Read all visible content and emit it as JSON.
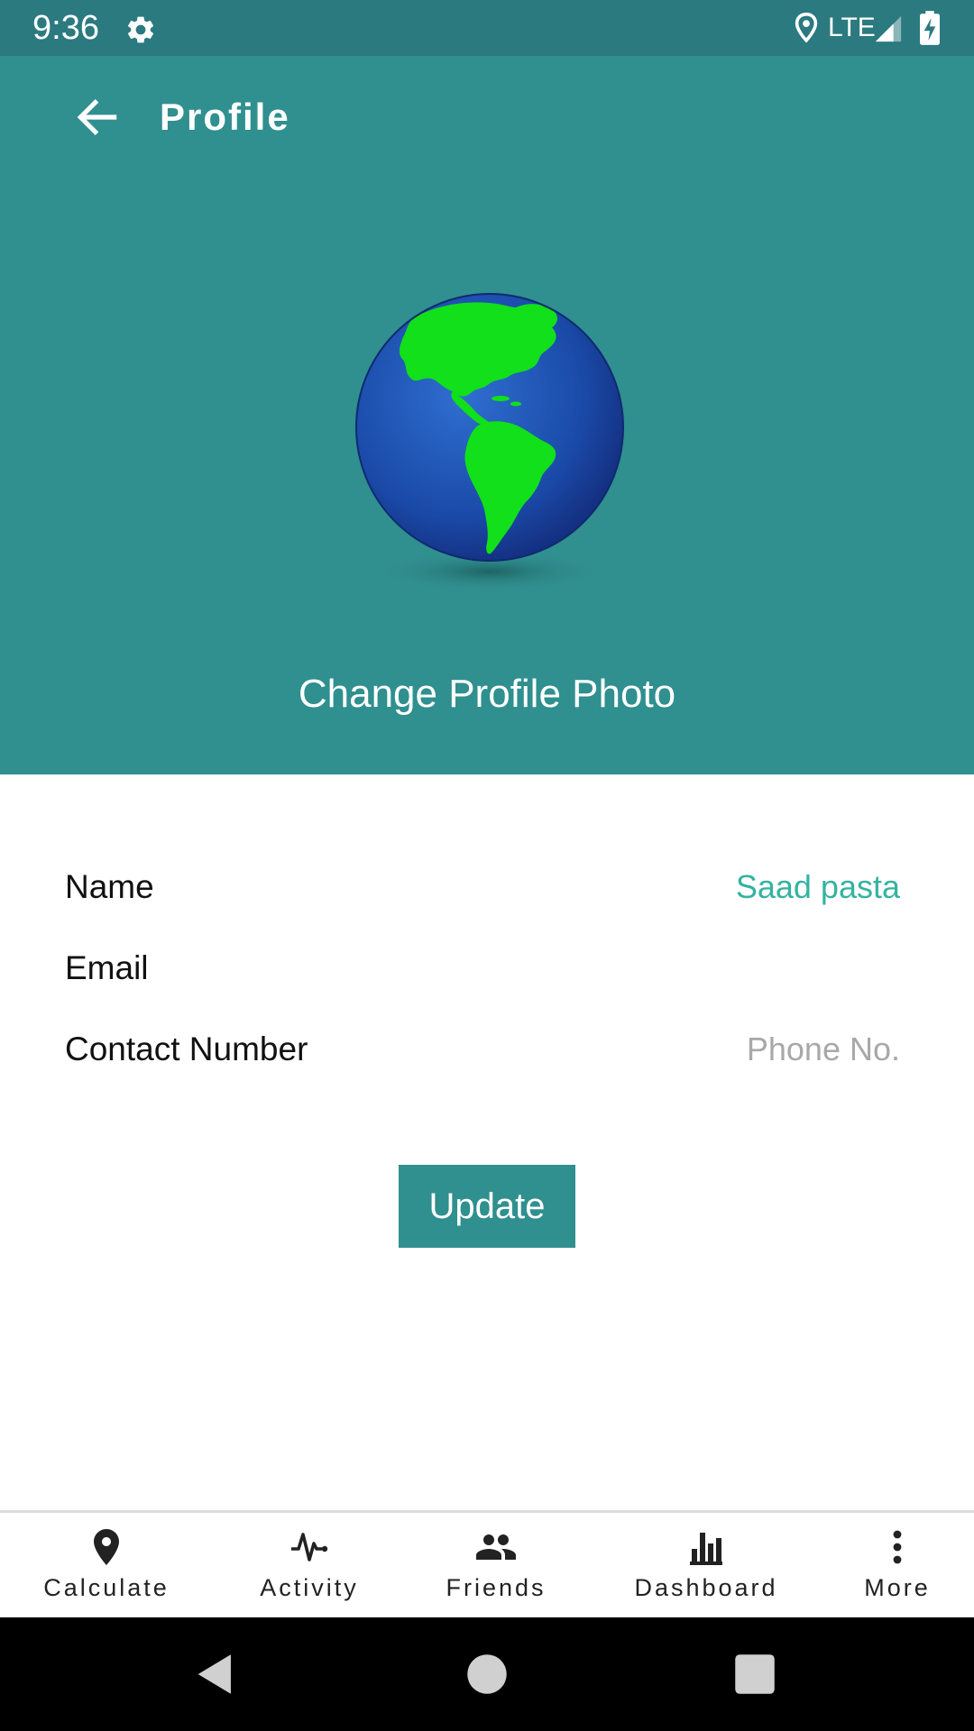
{
  "status_bar": {
    "time": "9:36",
    "network": "LTE",
    "icons": [
      "settings-gear-icon",
      "location-icon",
      "signal-icon",
      "battery-charging-icon"
    ]
  },
  "header": {
    "title": "Profile",
    "back_icon": "arrow-left-icon",
    "avatar_icon": "globe-americas",
    "change_photo_label": "Change Profile Photo",
    "background_color": "#308f8f"
  },
  "form": {
    "name_label": "Name",
    "name_value": "Saad pasta",
    "email_label": "Email",
    "email_value": "",
    "contact_label": "Contact Number",
    "contact_placeholder": "Phone No."
  },
  "update_button": {
    "label": "Update"
  },
  "bottom_nav": {
    "items": [
      {
        "label": "Calculate",
        "icon": "map-pin-icon"
      },
      {
        "label": "Activity",
        "icon": "pulse-icon"
      },
      {
        "label": "Friends",
        "icon": "people-icon"
      },
      {
        "label": "Dashboard",
        "icon": "bar-chart-icon"
      },
      {
        "label": "More",
        "icon": "more-vertical-icon"
      }
    ]
  },
  "colors": {
    "primary": "#308f8f",
    "status_bar": "#2b7a7f",
    "accent_text": "#35b3a0",
    "placeholder": "#a8a8a8"
  }
}
